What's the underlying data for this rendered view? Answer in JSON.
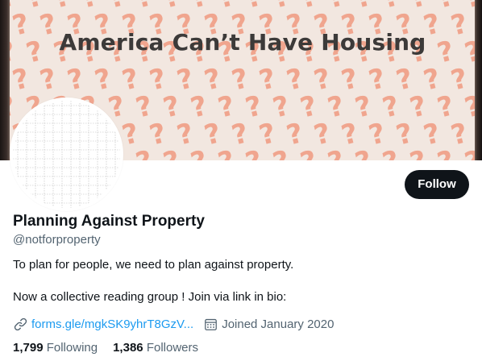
{
  "banner": {
    "title": "America Can’t Have Housing",
    "pattern_glyph": "?",
    "pattern_color": "#f0a58e",
    "background_color": "#f2e7e0"
  },
  "profile": {
    "display_name": "Planning Against Property",
    "handle": "@notforproperty",
    "bio_line_1": "To plan for people, we need to plan against property.",
    "bio_line_2": "Now a collective reading group ! Join via link in bio:",
    "link_icon": "link-icon",
    "link_text": "forms.gle/mgkSK9yhrT8GzV...",
    "calendar_icon": "calendar-icon",
    "joined_text": "Joined January 2020"
  },
  "actions": {
    "follow_label": "Follow"
  },
  "stats": {
    "following_count": "1,799",
    "following_label": "Following",
    "followers_count": "1,386",
    "followers_label": "Followers"
  },
  "colors": {
    "accent_link": "#1d9bf0",
    "primary_text": "#0f1419",
    "secondary_text": "#536471",
    "follow_button_bg": "#0f1419"
  }
}
